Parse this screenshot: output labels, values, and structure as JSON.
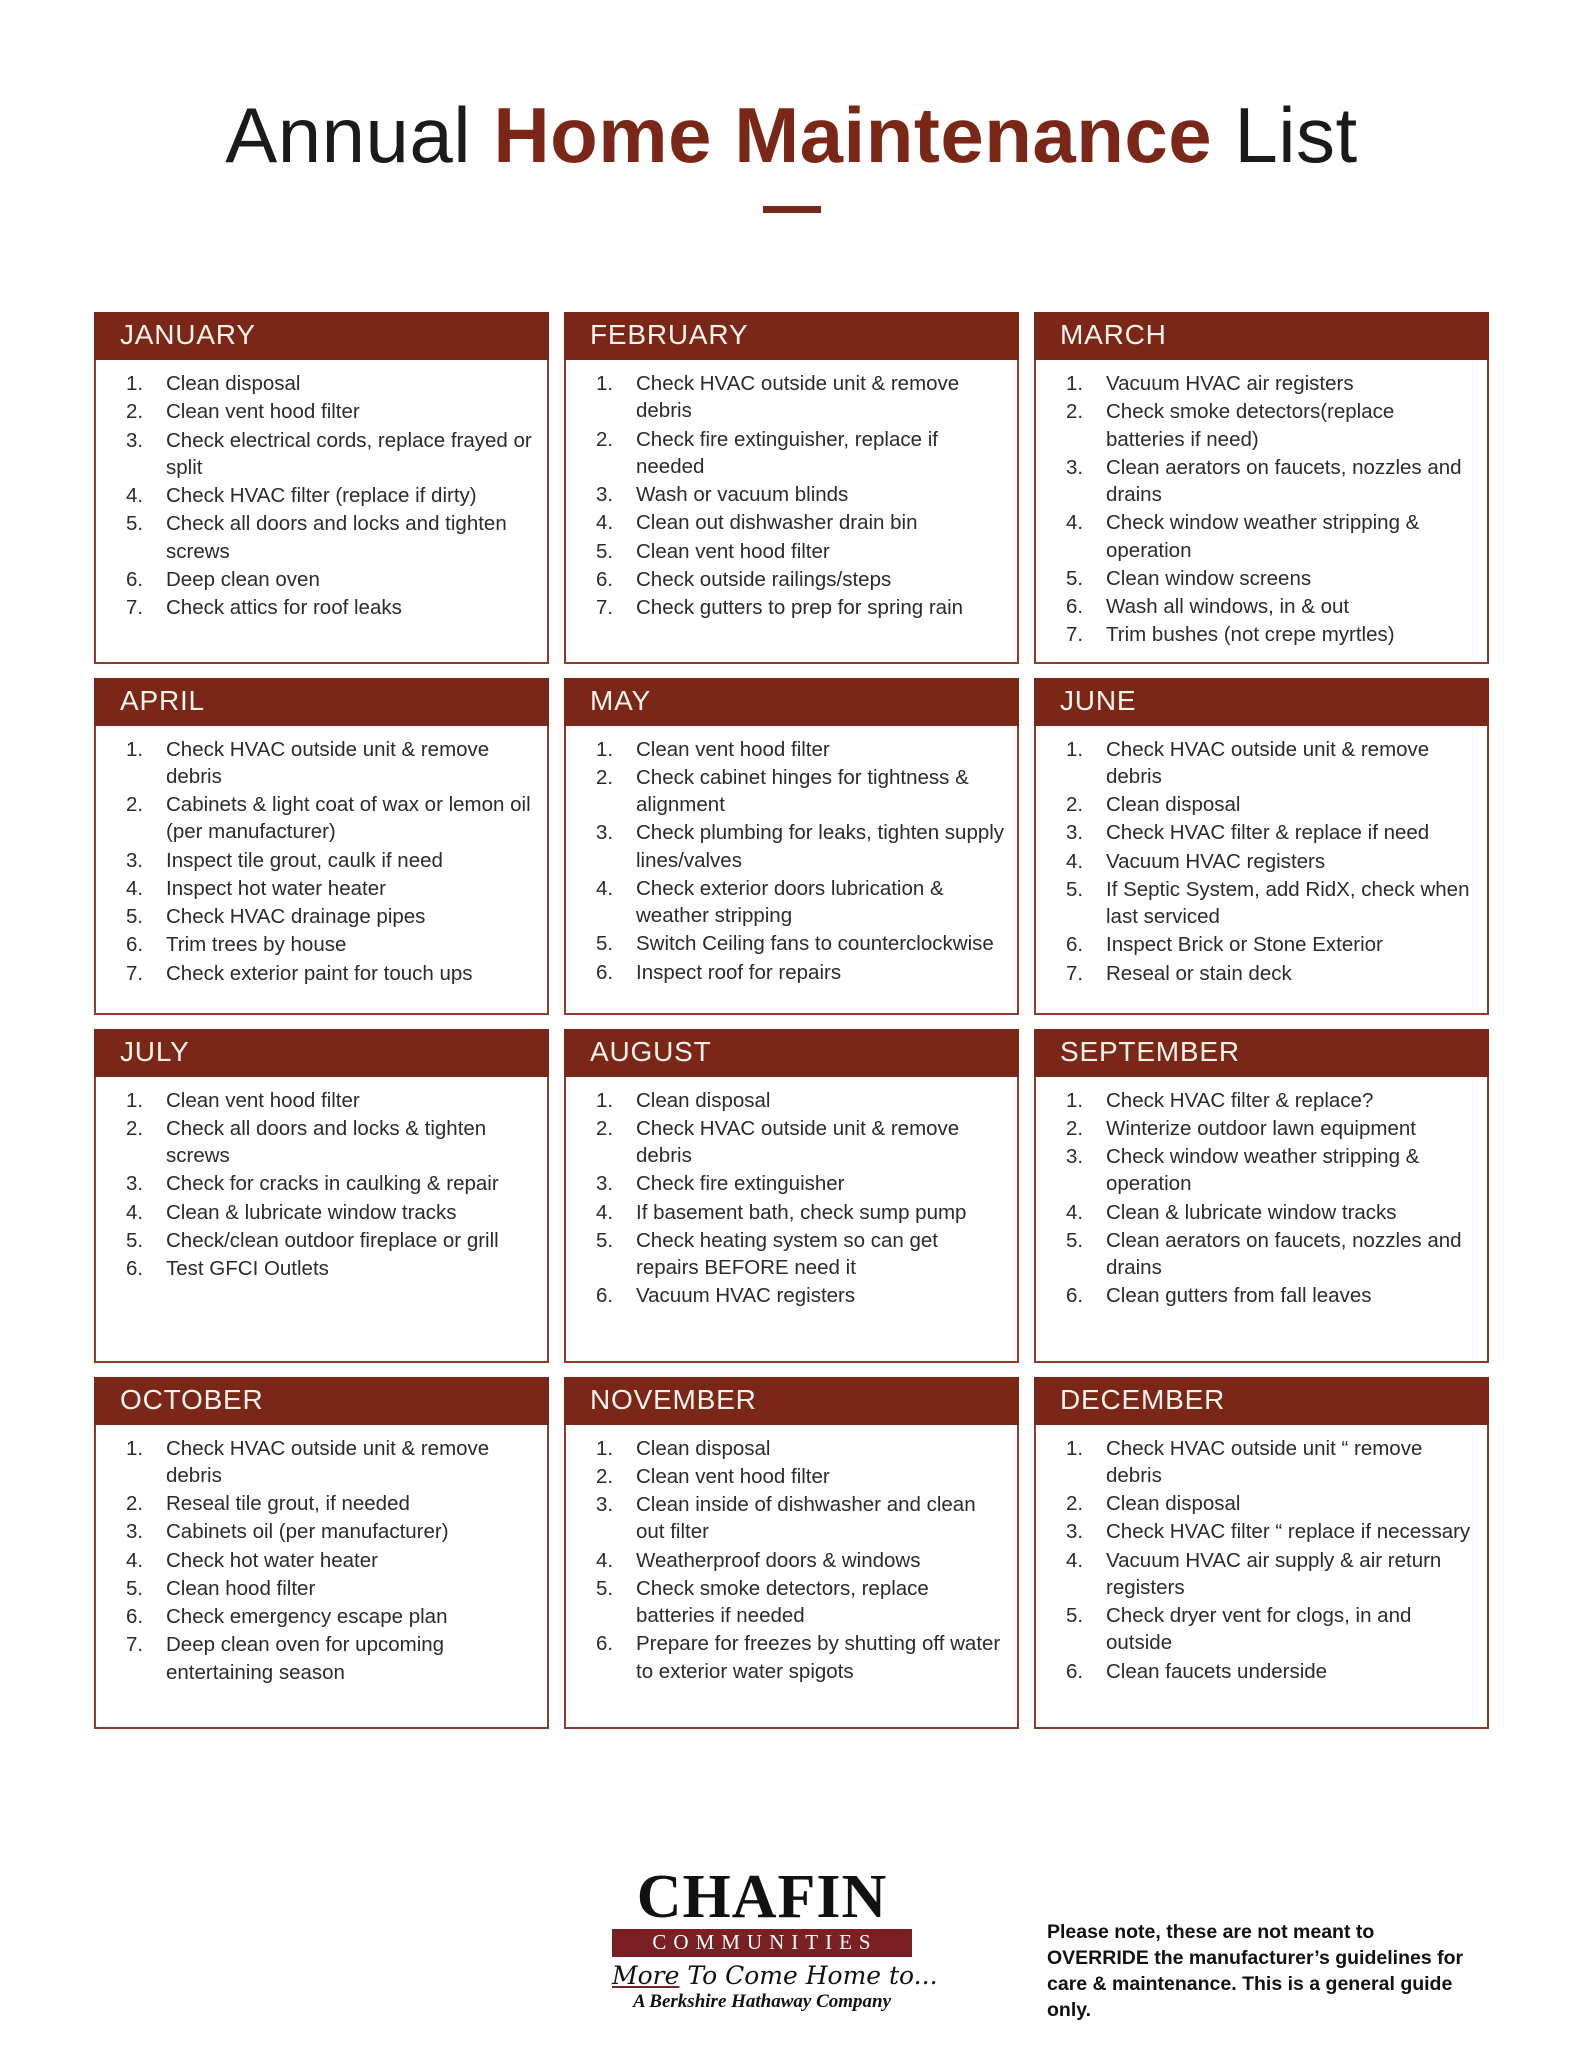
{
  "title": {
    "light_prefix": "Annual ",
    "bold_middle": "Home Maintenance",
    "light_suffix": " List"
  },
  "colors": {
    "header_bar": "#7a2718",
    "panel_border": "#8f3b2c",
    "logo_bar": "#7a1f22",
    "title_accent": "#7a2718"
  },
  "months": [
    {
      "name": "JANUARY",
      "tasks": [
        "Clean disposal",
        "Clean vent hood filter",
        "Check electrical cords, replace frayed or split",
        "Check HVAC filter (replace if dirty)",
        "Check all doors and locks and tighten screws",
        "Deep clean oven",
        "Check attics for roof leaks"
      ]
    },
    {
      "name": "FEBRUARY",
      "tasks": [
        "Check HVAC outside unit & remove debris",
        "Check fire extinguisher, replace if needed",
        "Wash or vacuum blinds",
        "Clean out dishwasher drain bin",
        "Clean vent hood filter",
        "Check  outside railings/steps",
        "Check gutters to prep for spring rain"
      ]
    },
    {
      "name": "MARCH",
      "tasks": [
        "Vacuum HVAC air registers",
        "Check smoke detectors(replace batteries if need)",
        "Clean aerators on faucets, nozzles and drains",
        "Check window weather stripping & operation",
        "Clean window screens",
        "Wash all windows, in & out",
        "Trim bushes (not crepe myrtles)"
      ]
    },
    {
      "name": "APRIL",
      "tasks": [
        "Check HVAC outside unit & remove debris",
        "Cabinets & light coat of wax or lemon oil (per manufacturer)",
        "Inspect tile grout, caulk if need",
        "Inspect hot water heater",
        "Check HVAC drainage pipes",
        "Trim trees by house",
        "Check exterior paint for touch ups"
      ]
    },
    {
      "name": "MAY",
      "tasks": [
        "Clean vent hood filter",
        "Check cabinet hinges for tightness & alignment",
        "Check plumbing for leaks, tighten supply lines/valves",
        "Check exterior doors lubrication & weather stripping",
        "Switch Ceiling fans to counterclockwise",
        "Inspect roof for repairs"
      ]
    },
    {
      "name": "JUNE",
      "tasks": [
        "Check HVAC outside unit & remove debris",
        "Clean disposal",
        "Check HVAC filter & replace if need",
        "Vacuum HVAC registers",
        "If Septic System, add RidX, check when last serviced",
        "Inspect Brick or Stone Exterior",
        "Reseal or stain deck"
      ]
    },
    {
      "name": "JULY",
      "tasks": [
        "Clean vent hood filter",
        "Check all doors and locks & tighten screws",
        "Check for cracks in caulking & repair",
        "Clean & lubricate window tracks",
        "Check/clean outdoor fireplace or grill",
        "Test GFCI Outlets"
      ]
    },
    {
      "name": "AUGUST",
      "tasks": [
        "Clean disposal",
        "Check HVAC outside unit & remove debris",
        "Check fire extinguisher",
        "If basement bath, check sump pump",
        "Check heating system so can get repairs BEFORE need it",
        "Vacuum HVAC registers"
      ]
    },
    {
      "name": "SEPTEMBER",
      "tasks": [
        "Check HVAC filter & replace?",
        "Winterize outdoor lawn equipment",
        "Check window weather stripping & operation",
        "Clean & lubricate window tracks",
        "Clean aerators on faucets, nozzles and drains",
        "Clean gutters from fall leaves"
      ]
    },
    {
      "name": "OCTOBER",
      "tasks": [
        "Check HVAC outside unit & remove debris",
        "Reseal tile grout, if needed",
        "Cabinets oil (per manufacturer)",
        "Check hot water heater",
        "Clean hood filter",
        "Check emergency escape plan",
        "Deep clean oven for upcoming entertaining season"
      ]
    },
    {
      "name": "NOVEMBER",
      "tasks": [
        "Clean disposal",
        "Clean vent hood filter",
        "Clean inside of dishwasher and clean out filter",
        "Weatherproof doors & windows",
        "Check smoke detectors, replace batteries if needed",
        "Prepare for freezes by shutting off water to exterior water spigots"
      ]
    },
    {
      "name": "DECEMBER",
      "tasks": [
        "Check HVAC outside unit “ remove debris",
        "Clean disposal",
        "Check HVAC filter “ replace if necessary",
        "Vacuum HVAC air supply & air return registers",
        "Check dryer vent for clogs, in and outside",
        "Clean faucets underside"
      ]
    }
  ],
  "footer": {
    "logo": {
      "brand": "CHAFIN",
      "bar": "COMMUNITIES",
      "tagline_underlined": "More",
      "tagline_rest": " To Come Home to...",
      "parent": "A Berkshire Hathaway Company"
    },
    "note": "Please note, these are not meant to OVERRIDE the manufacturer’s guidelines for care & maintenance.  This is a general guide only."
  }
}
